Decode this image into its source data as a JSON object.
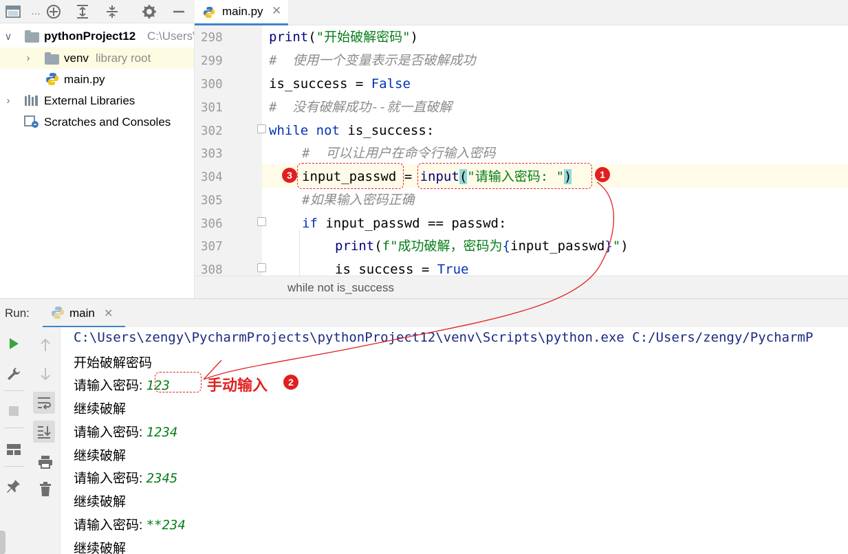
{
  "project_tree": {
    "rows": [
      {
        "label": "pythonProject12",
        "suffix": "C:\\Users\\"
      },
      {
        "label": "venv",
        "suffix": "library root"
      },
      {
        "label": "main.py",
        "suffix": ""
      },
      {
        "label": "External Libraries",
        "suffix": ""
      },
      {
        "label": "Scratches and Consoles",
        "suffix": ""
      }
    ]
  },
  "editor": {
    "tab_label": "main.py",
    "line_numbers": [
      "298",
      "299",
      "300",
      "301",
      "302",
      "303",
      "304",
      "305",
      "306",
      "307",
      "308"
    ],
    "breadcrumb": "while not is_success",
    "lines": {
      "l298_fn": "print",
      "l298_open": "(",
      "l298_str": "\"开始破解密码\"",
      "l298_close": ")",
      "l299_cmt": "#  使用一个变量表示是否破解成功",
      "l300_var": "is_success = ",
      "l300_kw": "False",
      "l301_cmt": "#  没有破解成功--就一直破解",
      "l302_kw1": "while",
      "l302_kw2": "not",
      "l302_rest": " is_success:",
      "l303_cmt": "#  可以让用户在命令行输入密码",
      "l304_var": "input_passwd",
      "l304_eq": " = ",
      "l304_fn": "input",
      "l304_open": "(",
      "l304_str": "\"请输入密码: \"",
      "l304_close": ")",
      "l305_cmt": "#如果输入密码正确",
      "l306_kw": "if",
      "l306_rest": " input_passwd == passwd:",
      "l307_fn": "print",
      "l307_open": "(",
      "l307_fpre": "f\"成功破解，密码为",
      "l307_brace_open": "{",
      "l307_expr": "input_passwd",
      "l307_brace_close": "}",
      "l307_fpost": "\"",
      "l307_close": ")",
      "l308_var": "is_success = ",
      "l308_kw": "True"
    }
  },
  "run_panel": {
    "label": "Run:",
    "tab_label": "main",
    "console": [
      {
        "text": "C:\\Users\\zengy\\PycharmProjects\\pythonProject12\\venv\\Scripts\\python.exe C:/Users/zengy/PycharmP",
        "input": ""
      },
      {
        "text": "开始破解密码",
        "input": ""
      },
      {
        "text": "请输入密码: ",
        "input": "123"
      },
      {
        "text": "继续破解",
        "input": ""
      },
      {
        "text": "请输入密码: ",
        "input": "1234"
      },
      {
        "text": "继续破解",
        "input": ""
      },
      {
        "text": "请输入密码: ",
        "input": "2345"
      },
      {
        "text": "继续破解",
        "input": ""
      },
      {
        "text": "请输入密码: ",
        "input": "**234"
      },
      {
        "text": "继续破解",
        "input": ""
      }
    ]
  },
  "annotations": {
    "badge_1": "1",
    "badge_2": "2",
    "badge_3": "3",
    "manual_input_label": "手动输入",
    "color": "#e02020"
  },
  "icons": {
    "toolbar": [
      "window-icon",
      "add-circle-icon",
      "expand-all-icon",
      "collapse-all-icon",
      "gear-icon",
      "minimize-icon"
    ],
    "run_toolbar": [
      "play-icon",
      "wrench-icon",
      "stop-icon",
      "layout-icon",
      "pin-icon",
      "up-arrow-icon",
      "down-arrow-icon",
      "soft-wrap-icon",
      "scroll-to-end-icon",
      "print-icon",
      "trash-icon"
    ]
  },
  "colors": {
    "keyword": "#0033b3",
    "string": "#067d17",
    "comment": "#8c8c8c",
    "accent": "#4083c9"
  }
}
